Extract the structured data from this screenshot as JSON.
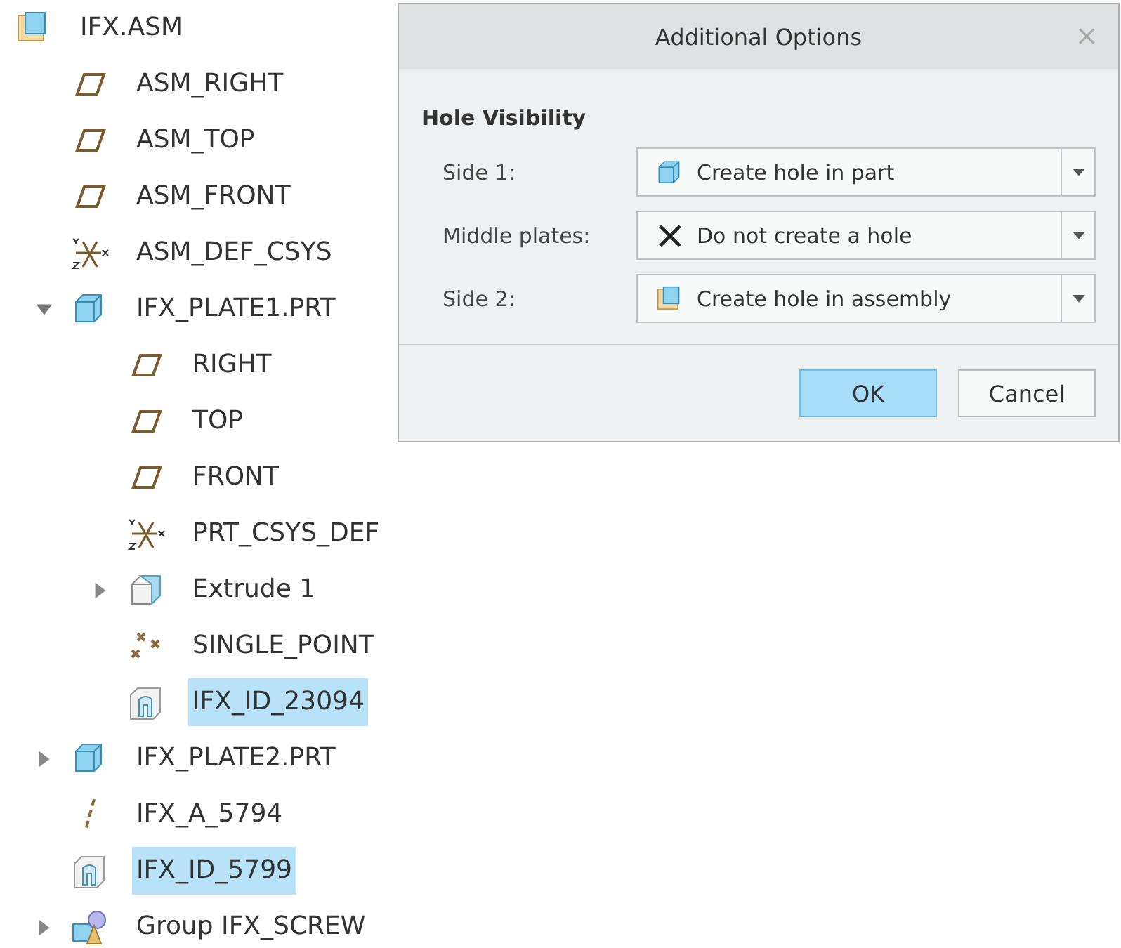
{
  "model_tree": {
    "items": [
      {
        "label": "IFX.ASM",
        "kind": "assembly",
        "selected": false,
        "children": [
          {
            "label": "ASM_RIGHT",
            "kind": "plane",
            "selected": false
          },
          {
            "label": "ASM_TOP",
            "kind": "plane",
            "selected": false
          },
          {
            "label": "ASM_FRONT",
            "kind": "plane",
            "selected": false
          },
          {
            "label": "ASM_DEF_CSYS",
            "kind": "csys",
            "selected": false
          },
          {
            "label": "IFX_PLATE1.PRT",
            "kind": "part",
            "selected": false,
            "expanded": true,
            "children": [
              {
                "label": "RIGHT",
                "kind": "plane",
                "selected": false
              },
              {
                "label": "TOP",
                "kind": "plane",
                "selected": false
              },
              {
                "label": "FRONT",
                "kind": "plane",
                "selected": false
              },
              {
                "label": "PRT_CSYS_DEF",
                "kind": "csys",
                "selected": false
              },
              {
                "label": "Extrude 1",
                "kind": "extrude",
                "selected": false,
                "expanded": false
              },
              {
                "label": "SINGLE_POINT",
                "kind": "point",
                "selected": false
              },
              {
                "label": "IFX_ID_23094",
                "kind": "cut",
                "selected": true
              }
            ]
          },
          {
            "label": "IFX_PLATE2.PRT",
            "kind": "part",
            "selected": false,
            "expanded": false
          },
          {
            "label": "IFX_A_5794",
            "kind": "axis",
            "selected": false
          },
          {
            "label": "IFX_ID_5799",
            "kind": "cut",
            "selected": true
          },
          {
            "label": "Group IFX_SCREW",
            "kind": "group",
            "selected": false,
            "expanded": false
          }
        ]
      }
    ]
  },
  "dialog": {
    "title": "Additional Options",
    "close": "×",
    "section": "Hole Visibility",
    "fields": [
      {
        "label": "Side 1:",
        "value": "Create hole in part",
        "kind": "part"
      },
      {
        "label": "Middle plates:",
        "value": "Do not create a hole",
        "kind": "none"
      },
      {
        "label": "Side 2:",
        "value": "Create hole in assembly",
        "kind": "assembly"
      }
    ],
    "buttons": [
      {
        "label": "OK",
        "default": true
      },
      {
        "label": "Cancel",
        "default": false
      }
    ]
  }
}
